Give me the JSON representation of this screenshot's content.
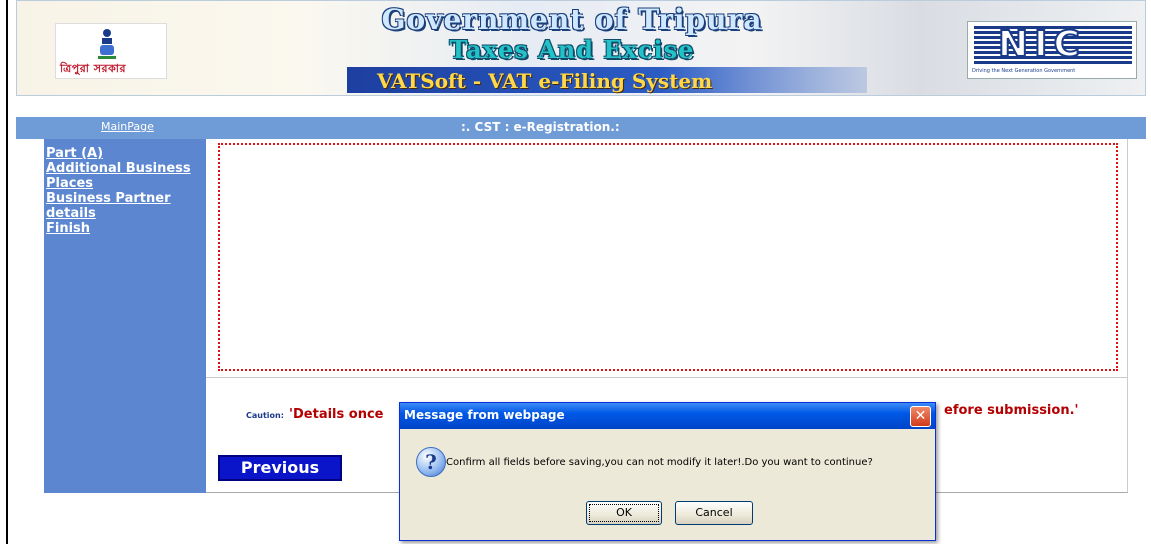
{
  "banner": {
    "org_title": "Government of Tripura",
    "dept_title": "Taxes And Excise",
    "system_title": "VATSoft - VAT e-Filing System",
    "state_logo_text": "ত্রিপুরা সরকার",
    "nic_logo_text": "NIC",
    "nic_tagline": "Driving the Next Generation Government"
  },
  "navbar": {
    "main_page_link": "MainPage",
    "page_title": ":. CST : e-Registration.:"
  },
  "sidebar": {
    "items": [
      {
        "label": "Part (A)"
      },
      {
        "label": "Additional Business Places"
      },
      {
        "label": "Business Partner details"
      },
      {
        "label": "Finish"
      }
    ]
  },
  "content": {
    "caution_label": "Caution:",
    "caution_text_left": "'Details once",
    "caution_text_right": "efore submission.'",
    "previous_button": "Previous"
  },
  "dialog": {
    "title": "Message from webpage",
    "close_symbol": "✕",
    "icon_symbol": "?",
    "message": "Confirm all fields before saving,you can not modify it later!.Do you want to continue?",
    "ok_label": "OK",
    "cancel_label": "Cancel"
  },
  "colors": {
    "navbar": "#6f9bd6",
    "sidebar": "#5c87d0",
    "caution_red": "#b40000",
    "previous_button": "#0a14c8",
    "dialog_titlebar": "#0058e6"
  }
}
